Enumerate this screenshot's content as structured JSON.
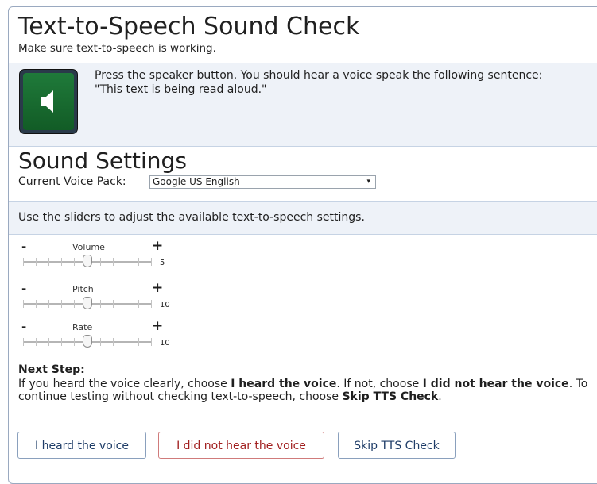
{
  "header": {
    "title": "Text-to-Speech Sound Check",
    "subtitle": "Make sure text-to-speech is working."
  },
  "speaker": {
    "icon": "speaker-icon",
    "instruction": "Press the speaker button. You should hear a voice speak the following sentence: \"This text is being read aloud.\""
  },
  "settings": {
    "title": "Sound Settings",
    "voice_pack_label": "Current Voice Pack:",
    "voice_pack_value": "Google US English",
    "slider_note": "Use the sliders to adjust the available text-to-speech settings."
  },
  "sliders": [
    {
      "label": "Volume",
      "value": "5",
      "level": 0.5
    },
    {
      "label": "Pitch",
      "value": "10",
      "level": 0.5
    },
    {
      "label": "Rate",
      "value": "10",
      "level": 0.5
    }
  ],
  "slider_symbols": {
    "minus": "-",
    "plus": "+"
  },
  "next_step": {
    "heading": "Next Step:",
    "t1": "If you heard the voice clearly, choose ",
    "b1": "I heard the voice",
    "t2": ". If not, choose ",
    "b2": "I did not hear the voice",
    "t3": ". To continue testing without checking text-to-speech, choose ",
    "b3": "Skip TTS Check",
    "t4": "."
  },
  "buttons": {
    "heard": "I heard the voice",
    "not_heard": "I did not hear the voice",
    "skip": "Skip TTS Check"
  }
}
